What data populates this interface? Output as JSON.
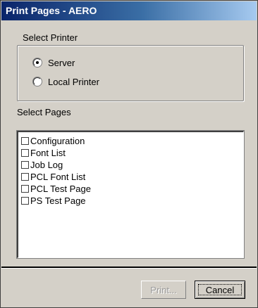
{
  "window": {
    "title": "Print Pages - AERO"
  },
  "printer_group": {
    "label": "Select Printer",
    "options": [
      {
        "label": "Server",
        "selected": true
      },
      {
        "label": "Local Printer",
        "selected": false
      }
    ]
  },
  "pages": {
    "label": "Select Pages",
    "items": [
      {
        "label": "Configuration",
        "checked": false
      },
      {
        "label": "Font List",
        "checked": false
      },
      {
        "label": "Job Log",
        "checked": false
      },
      {
        "label": "PCL Font List",
        "checked": false
      },
      {
        "label": "PCL Test Page",
        "checked": false
      },
      {
        "label": "PS Test Page",
        "checked": false
      }
    ]
  },
  "buttons": {
    "print_label": "Print...",
    "print_enabled": false,
    "cancel_label": "Cancel"
  },
  "colors": {
    "title_bar_start": "#0a246a",
    "title_bar_end": "#a6caf0",
    "face": "#d4d0c8",
    "disabled_text": "#9a9a9a"
  }
}
